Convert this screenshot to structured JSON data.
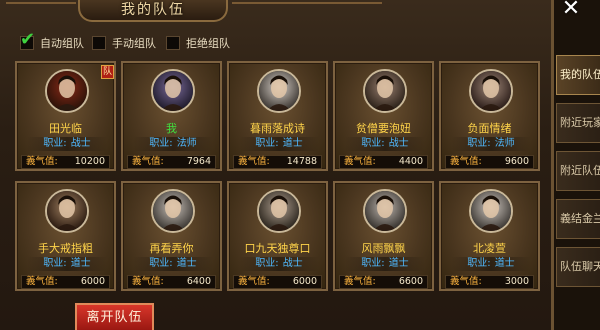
{
  "panel": {
    "title": "我的队伍",
    "close_icon": "close-icon"
  },
  "options": [
    {
      "label": "自动组队",
      "checked": true
    },
    {
      "label": "手动组队",
      "checked": false
    },
    {
      "label": "拒绝组队",
      "checked": false
    }
  ],
  "members": [
    {
      "name": "田光临",
      "job_label": "职业:",
      "job": "战士",
      "yq_label": "義气值:",
      "yq": "10200",
      "leader": true,
      "leader_badge": "队",
      "me": false
    },
    {
      "name": "我",
      "job_label": "职业:",
      "job": "法师",
      "yq_label": "義气值:",
      "yq": "7964",
      "leader": false,
      "me": true
    },
    {
      "name": "暮雨落成诗",
      "job_label": "职业:",
      "job": "道士",
      "yq_label": "義气值:",
      "yq": "14788",
      "leader": false,
      "me": false
    },
    {
      "name": "贫僧要泡妞",
      "job_label": "职业:",
      "job": "战士",
      "yq_label": "義气值:",
      "yq": "4400",
      "leader": false,
      "me": false
    },
    {
      "name": "负面情绪",
      "job_label": "职业:",
      "job": "法师",
      "yq_label": "義气值:",
      "yq": "9600",
      "leader": false,
      "me": false
    },
    {
      "name": "手大戒指粗",
      "job_label": "职业:",
      "job": "道士",
      "yq_label": "義气值:",
      "yq": "6000",
      "leader": false,
      "me": false
    },
    {
      "name": "再看弄你",
      "job_label": "职业:",
      "job": "道士",
      "yq_label": "義气值:",
      "yq": "6400",
      "leader": false,
      "me": false
    },
    {
      "name": "口九天独尊口",
      "job_label": "职业:",
      "job": "战士",
      "yq_label": "義气值:",
      "yq": "6000",
      "leader": false,
      "me": false
    },
    {
      "name": "风雨飘飘",
      "job_label": "职业:",
      "job": "道士",
      "yq_label": "義气值:",
      "yq": "6600",
      "leader": false,
      "me": false
    },
    {
      "name": "北凌萱",
      "job_label": "职业:",
      "job": "道士",
      "yq_label": "義气值:",
      "yq": "3000",
      "leader": false,
      "me": false
    }
  ],
  "leave_button": "离开队伍",
  "side_tabs": [
    {
      "label": "我的队伍",
      "active": true
    },
    {
      "label": "附近玩家",
      "active": false
    },
    {
      "label": "附近队伍",
      "active": false
    },
    {
      "label": "義结金兰",
      "active": false
    },
    {
      "label": "队伍聊天",
      "active": false
    }
  ]
}
